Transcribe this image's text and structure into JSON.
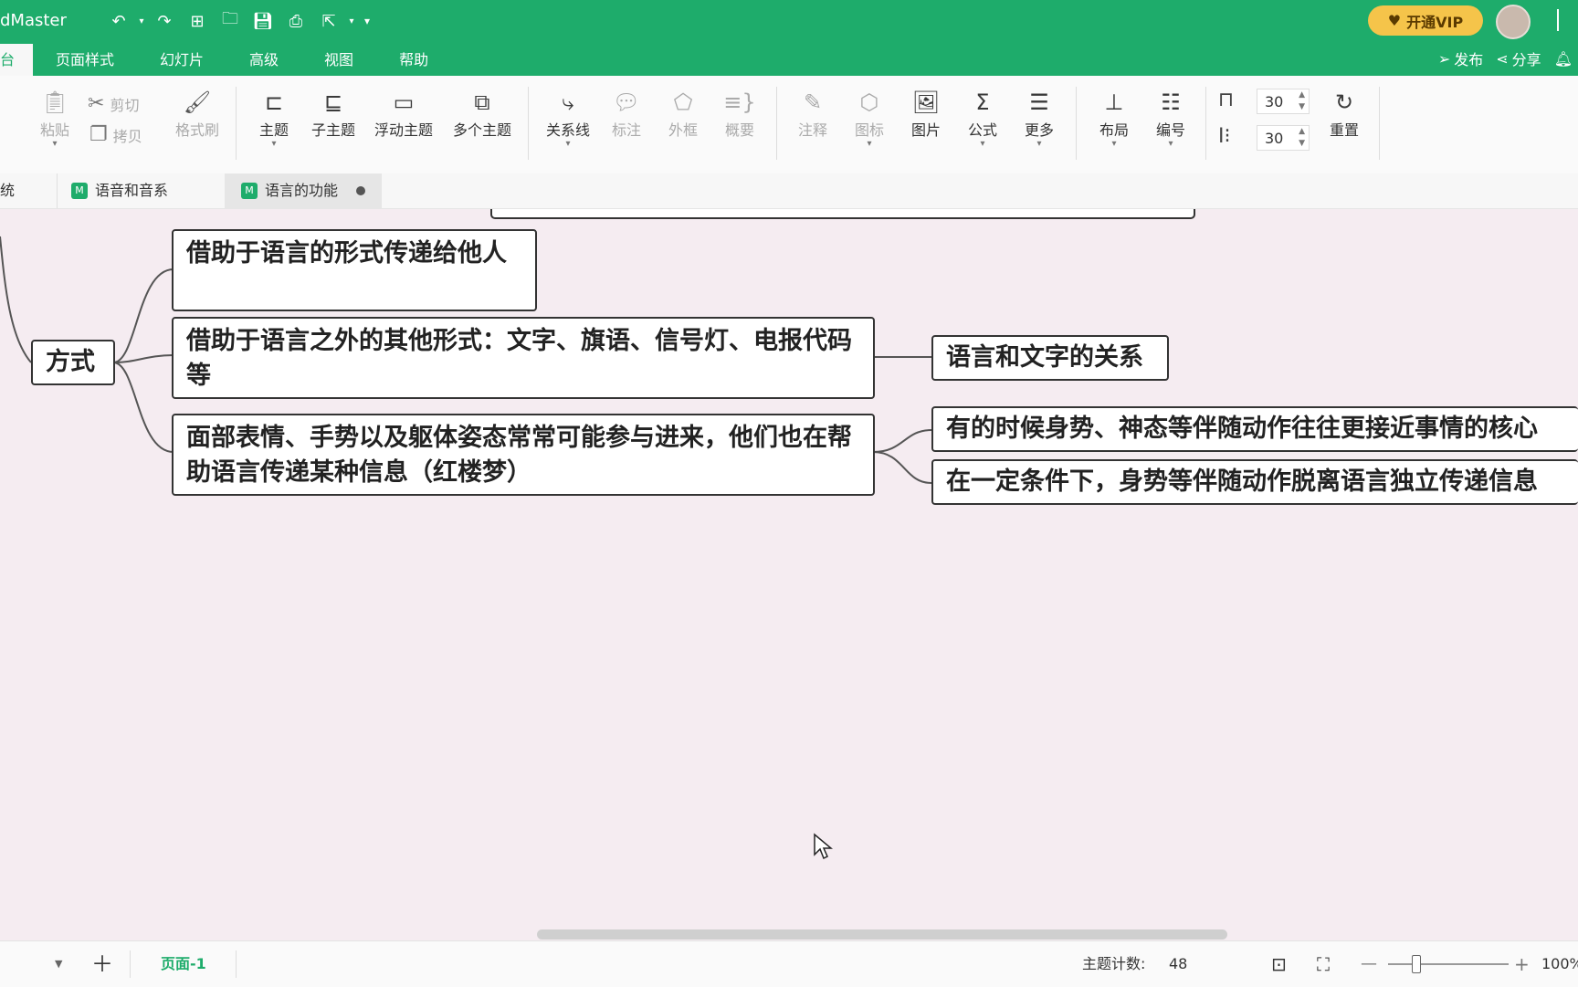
{
  "app": {
    "title": "dMaster",
    "vip_label": "开通VIP"
  },
  "menus": [
    "台",
    "页面样式",
    "幻灯片",
    "高级",
    "视图",
    "帮助"
  ],
  "top_actions": {
    "publish": "发布",
    "share": "分享"
  },
  "toolbar": {
    "paste": "粘贴",
    "cut": "剪切",
    "copy": "拷贝",
    "format_painter": "格式刷",
    "topic": "主题",
    "subtopic": "子主题",
    "floating_topic": "浮动主题",
    "multi_topic": "多个主题",
    "relationship": "关系线",
    "callout": "标注",
    "boundary": "外框",
    "summary": "概要",
    "note": "注释",
    "icon": "图标",
    "image": "图片",
    "formula": "公式",
    "more": "更多",
    "layout": "布局",
    "numbering": "编号",
    "spacing_h": "30",
    "spacing_v": "30",
    "reset": "重置"
  },
  "tabs": [
    {
      "label": "统"
    },
    {
      "label": "语音和音系"
    },
    {
      "label": "语言的功能"
    }
  ],
  "mindmap": {
    "parent": "方式",
    "children": [
      "借助于语言的形式传递给他人",
      "借助于语言之外的其他形式：文字、旗语、信号灯、电报代码等",
      "面部表情、手势以及躯体姿态常常可能参与进来，他们也在帮助语言传递某种信息（红楼梦）"
    ],
    "subtopics": [
      "语言和文字的关系",
      "有的时候身势、神态等伴随动作往往更接近事情的核心",
      "在一定条件下，身势等伴随动作脱离语言独立传递信息"
    ]
  },
  "status": {
    "page": "页面-1",
    "topic_count_label": "主题计数:",
    "topic_count": "48",
    "zoom": "100%"
  }
}
